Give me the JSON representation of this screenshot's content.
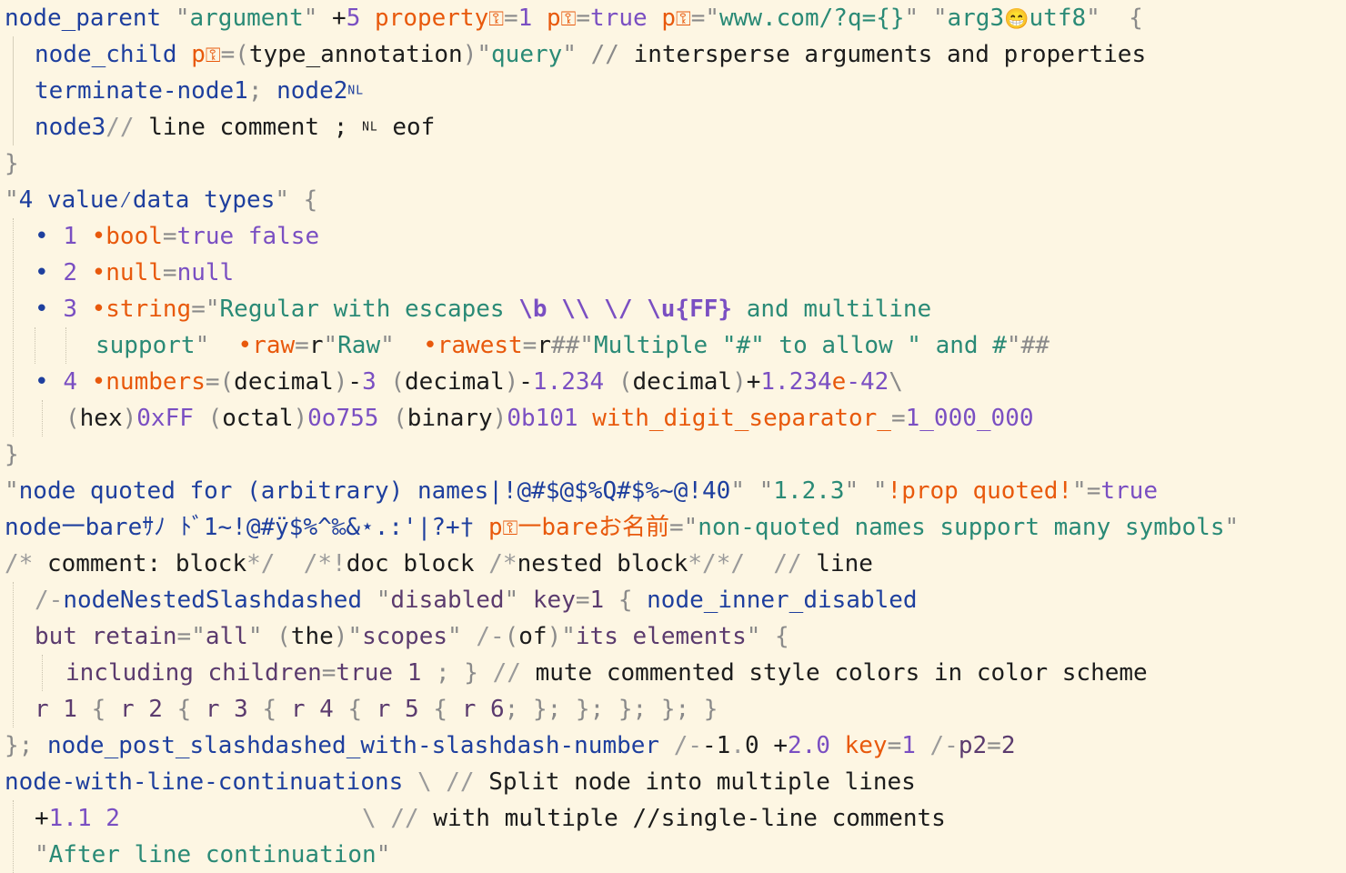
{
  "theme": {
    "background": "#fdf6e3",
    "node": "#1e3f9e",
    "string": "#2a8a76",
    "key": "#e8590c",
    "value": "#7a4fc2",
    "comment": "#9a9a9a"
  },
  "icons": {
    "key_placeholder": "key-placeholder-icon",
    "emoji": "grinning-face-icon"
  },
  "lines": [
    {
      "tokens": [
        {
          "c": "n",
          "t": "node_parent "
        },
        {
          "c": "q",
          "t": "\""
        },
        {
          "c": "s",
          "t": "argument"
        },
        {
          "c": "q",
          "t": "\""
        },
        {
          "c": "t",
          "t": " +"
        },
        {
          "c": "v",
          "t": "5 "
        },
        {
          "c": "k",
          "t": "property"
        },
        {
          "c": "k",
          "t": "⚿",
          "icon": "key-placeholder-icon"
        },
        {
          "c": "p",
          "t": "="
        },
        {
          "c": "v",
          "t": "1 "
        },
        {
          "c": "k",
          "t": "p"
        },
        {
          "c": "k",
          "t": "⚿",
          "icon": "key-placeholder-icon"
        },
        {
          "c": "p",
          "t": "="
        },
        {
          "c": "v",
          "t": "true "
        },
        {
          "c": "k",
          "t": "p"
        },
        {
          "c": "k",
          "t": "⚿",
          "icon": "key-placeholder-icon"
        },
        {
          "c": "p",
          "t": "="
        },
        {
          "c": "q",
          "t": "\""
        },
        {
          "c": "s",
          "t": "www.com/?q={}"
        },
        {
          "c": "q",
          "t": "\" "
        },
        {
          "c": "q",
          "t": "\""
        },
        {
          "c": "s",
          "t": "arg3"
        },
        {
          "c": "t",
          "t": "😁",
          "icon": "grinning-face-icon"
        },
        {
          "c": "s",
          "t": "utf8"
        },
        {
          "c": "q",
          "t": "\"  {"
        }
      ]
    },
    {
      "tokens": [
        {
          "c": "n",
          "t": "node_child "
        },
        {
          "c": "k",
          "t": "p"
        },
        {
          "c": "k",
          "t": "⚿",
          "icon": "key-placeholder-icon"
        },
        {
          "c": "p",
          "t": "=("
        },
        {
          "c": "t",
          "t": "type_annotation"
        },
        {
          "c": "p",
          "t": ")"
        },
        {
          "c": "q",
          "t": "\""
        },
        {
          "c": "s",
          "t": "query"
        },
        {
          "c": "q",
          "t": "\" // "
        },
        {
          "c": "t",
          "t": "intersperse arguments and properties"
        }
      ]
    },
    {
      "tokens": [
        {
          "c": "n",
          "t": "terminate-node1"
        },
        {
          "c": "p",
          "t": "; "
        },
        {
          "c": "n",
          "t": "node2"
        },
        {
          "c": "b",
          "t": "NL",
          "small": true
        }
      ]
    },
    {
      "tokens": [
        {
          "c": "n",
          "t": "node3"
        },
        {
          "c": "c",
          "t": "// "
        },
        {
          "c": "t",
          "t": "line comment ; "
        },
        {
          "c": "t",
          "t": "NL",
          "small": true
        },
        {
          "c": "t",
          "t": " eof"
        }
      ]
    },
    {
      "tokens": [
        {
          "c": "p",
          "t": "}"
        }
      ]
    },
    {
      "tokens": [
        {
          "c": "q",
          "t": "\""
        },
        {
          "c": "n",
          "t": "4 value⁄data types"
        },
        {
          "c": "q",
          "t": "\" {"
        }
      ]
    },
    {
      "tokens": [
        {
          "c": "b",
          "t": "• "
        },
        {
          "c": "v",
          "t": "1 "
        },
        {
          "c": "k",
          "t": "•bool"
        },
        {
          "c": "p",
          "t": "="
        },
        {
          "c": "v",
          "t": "true false"
        }
      ]
    },
    {
      "tokens": [
        {
          "c": "b",
          "t": "• "
        },
        {
          "c": "v",
          "t": "2 "
        },
        {
          "c": "k",
          "t": "•null"
        },
        {
          "c": "p",
          "t": "="
        },
        {
          "c": "v",
          "t": "null"
        }
      ]
    },
    {
      "tokens": [
        {
          "c": "b",
          "t": "• "
        },
        {
          "c": "v",
          "t": "3 "
        },
        {
          "c": "k",
          "t": "•string"
        },
        {
          "c": "p",
          "t": "="
        },
        {
          "c": "q",
          "t": "\""
        },
        {
          "c": "s",
          "t": "Regular with escapes "
        },
        {
          "c": "v",
          "t": "\\b \\\\ \\/ \\u{FF}",
          "bold": true
        },
        {
          "c": "s",
          "t": " and multiline"
        }
      ]
    },
    {
      "tokens": [
        {
          "c": "s",
          "t": "support"
        },
        {
          "c": "q",
          "t": "\"  "
        },
        {
          "c": "k",
          "t": "•raw"
        },
        {
          "c": "p",
          "t": "="
        },
        {
          "c": "t",
          "t": "r"
        },
        {
          "c": "q",
          "t": "\""
        },
        {
          "c": "s",
          "t": "Raw"
        },
        {
          "c": "q",
          "t": "\"  "
        },
        {
          "c": "k",
          "t": "•rawest"
        },
        {
          "c": "p",
          "t": "="
        },
        {
          "c": "t",
          "t": "r"
        },
        {
          "c": "q",
          "t": "##\""
        },
        {
          "c": "s",
          "t": "Multiple \"#\" to allow \" and #"
        },
        {
          "c": "q",
          "t": "\"##"
        }
      ]
    },
    {
      "tokens": [
        {
          "c": "b",
          "t": "• "
        },
        {
          "c": "v",
          "t": "4 "
        },
        {
          "c": "k",
          "t": "•numbers"
        },
        {
          "c": "p",
          "t": "=("
        },
        {
          "c": "t",
          "t": "decimal"
        },
        {
          "c": "p",
          "t": ")"
        },
        {
          "c": "t",
          "t": "-"
        },
        {
          "c": "v",
          "t": "3 "
        },
        {
          "c": "p",
          "t": "("
        },
        {
          "c": "t",
          "t": "decimal"
        },
        {
          "c": "p",
          "t": ")"
        },
        {
          "c": "t",
          "t": "-"
        },
        {
          "c": "v",
          "t": "1.234 "
        },
        {
          "c": "p",
          "t": "("
        },
        {
          "c": "t",
          "t": "decimal"
        },
        {
          "c": "p",
          "t": ")"
        },
        {
          "c": "t",
          "t": "+"
        },
        {
          "c": "v",
          "t": "1.234"
        },
        {
          "c": "k",
          "t": "e"
        },
        {
          "c": "v",
          "t": "-42"
        },
        {
          "c": "p",
          "t": "\\"
        }
      ]
    },
    {
      "tokens": [
        {
          "c": "p",
          "t": "("
        },
        {
          "c": "t",
          "t": "hex"
        },
        {
          "c": "p",
          "t": ")"
        },
        {
          "c": "v",
          "t": "0xFF "
        },
        {
          "c": "p",
          "t": "("
        },
        {
          "c": "t",
          "t": "octal"
        },
        {
          "c": "p",
          "t": ")"
        },
        {
          "c": "v",
          "t": "0o755 "
        },
        {
          "c": "p",
          "t": "("
        },
        {
          "c": "t",
          "t": "binary"
        },
        {
          "c": "p",
          "t": ")"
        },
        {
          "c": "v",
          "t": "0b101 "
        },
        {
          "c": "k",
          "t": "with_digit_separator_"
        },
        {
          "c": "p",
          "t": "="
        },
        {
          "c": "v",
          "t": "1_000_000"
        }
      ]
    },
    {
      "tokens": [
        {
          "c": "p",
          "t": "}"
        }
      ]
    },
    {
      "tokens": [
        {
          "c": "q",
          "t": "\""
        },
        {
          "c": "n",
          "t": "node quoted for (arbitrary) names|!@#$@$%Q#$%~@!40"
        },
        {
          "c": "q",
          "t": "\" "
        },
        {
          "c": "q",
          "t": "\""
        },
        {
          "c": "s",
          "t": "1.2.3"
        },
        {
          "c": "q",
          "t": "\" "
        },
        {
          "c": "q",
          "t": "\""
        },
        {
          "c": "k",
          "t": "!prop quoted!"
        },
        {
          "c": "q",
          "t": "\"="
        },
        {
          "c": "v",
          "t": "true"
        }
      ]
    },
    {
      "tokens": [
        {
          "c": "n",
          "t": "node一bareｻﾉ ﾄﾞ1~!@#ÿ$%^‰&⋆.:'|?+†"
        },
        {
          "c": "t",
          "t": " "
        },
        {
          "c": "k",
          "t": "p"
        },
        {
          "c": "k",
          "t": "⚿",
          "icon": "key-placeholder-icon"
        },
        {
          "c": "k",
          "t": "一bareお名前"
        },
        {
          "c": "p",
          "t": "="
        },
        {
          "c": "q",
          "t": "\""
        },
        {
          "c": "s",
          "t": "non-quoted names support many symbols"
        },
        {
          "c": "q",
          "t": "\""
        }
      ]
    },
    {
      "tokens": [
        {
          "c": "c",
          "t": "/* "
        },
        {
          "c": "t",
          "t": "comment: block"
        },
        {
          "c": "c",
          "t": "*/  /*!"
        },
        {
          "c": "t",
          "t": "doc block "
        },
        {
          "c": "c",
          "t": "/*"
        },
        {
          "c": "t",
          "t": "nested block"
        },
        {
          "c": "c",
          "t": "*/*/  // "
        },
        {
          "c": "t",
          "t": "line"
        }
      ]
    },
    {
      "tokens": [
        {
          "c": "c",
          "t": "/-"
        },
        {
          "c": "n",
          "t": "nodeNestedSlashdashed "
        },
        {
          "c": "q",
          "t": "\""
        },
        {
          "c": "d",
          "t": "disabled"
        },
        {
          "c": "q",
          "t": "\" "
        },
        {
          "c": "d",
          "t": "key"
        },
        {
          "c": "p",
          "t": "="
        },
        {
          "c": "d",
          "t": "1 "
        },
        {
          "c": "p",
          "t": "{ "
        },
        {
          "c": "n",
          "t": "node_inner_disabled"
        }
      ]
    },
    {
      "tokens": [
        {
          "c": "d",
          "t": "but retain"
        },
        {
          "c": "p",
          "t": "="
        },
        {
          "c": "q",
          "t": "\""
        },
        {
          "c": "d",
          "t": "all"
        },
        {
          "c": "q",
          "t": "\" "
        },
        {
          "c": "p",
          "t": "("
        },
        {
          "c": "t",
          "t": "the"
        },
        {
          "c": "p",
          "t": ")"
        },
        {
          "c": "q",
          "t": "\""
        },
        {
          "c": "d",
          "t": "scopes"
        },
        {
          "c": "q",
          "t": "\" "
        },
        {
          "c": "c",
          "t": "/-"
        },
        {
          "c": "p",
          "t": "("
        },
        {
          "c": "t",
          "t": "of"
        },
        {
          "c": "p",
          "t": ")"
        },
        {
          "c": "q",
          "t": "\""
        },
        {
          "c": "d",
          "t": "its elements"
        },
        {
          "c": "q",
          "t": "\" {"
        }
      ]
    },
    {
      "tokens": [
        {
          "c": "d",
          "t": "including children"
        },
        {
          "c": "p",
          "t": "="
        },
        {
          "c": "d",
          "t": "true 1 "
        },
        {
          "c": "p",
          "t": "; } "
        },
        {
          "c": "c",
          "t": "// "
        },
        {
          "c": "t",
          "t": "mute commented style colors in color scheme"
        }
      ]
    },
    {
      "tokens": [
        {
          "c": "d",
          "t": "r 1 "
        },
        {
          "c": "p",
          "t": "{ "
        },
        {
          "c": "d",
          "t": "r 2 "
        },
        {
          "c": "p",
          "t": "{ "
        },
        {
          "c": "d",
          "t": "r 3 "
        },
        {
          "c": "p",
          "t": "{ "
        },
        {
          "c": "d",
          "t": "r 4 "
        },
        {
          "c": "p",
          "t": "{ "
        },
        {
          "c": "d",
          "t": "r 5 "
        },
        {
          "c": "p",
          "t": "{ "
        },
        {
          "c": "d",
          "t": "r 6"
        },
        {
          "c": "p",
          "t": "; }; }; }; }; }"
        }
      ]
    },
    {
      "tokens": [
        {
          "c": "p",
          "t": "}; "
        },
        {
          "c": "n",
          "t": "node_post_slashdashed_with-slashdash-number "
        },
        {
          "c": "c",
          "t": "/-"
        },
        {
          "c": "t",
          "t": "-1"
        },
        {
          "c": "c",
          "t": "."
        },
        {
          "c": "t",
          "t": "0 "
        },
        {
          "c": "t",
          "t": "+"
        },
        {
          "c": "v",
          "t": "2.0 "
        },
        {
          "c": "k",
          "t": "key"
        },
        {
          "c": "p",
          "t": "="
        },
        {
          "c": "v",
          "t": "1 "
        },
        {
          "c": "c",
          "t": "/-"
        },
        {
          "c": "d",
          "t": "p2"
        },
        {
          "c": "p",
          "t": "="
        },
        {
          "c": "d",
          "t": "2"
        }
      ]
    },
    {
      "tokens": [
        {
          "c": "n",
          "t": "node-with-line-continuations "
        },
        {
          "c": "c",
          "t": "\\ // "
        },
        {
          "c": "t",
          "t": "Split node into multiple lines"
        }
      ]
    },
    {
      "tokens": [
        {
          "c": "t",
          "t": "+"
        },
        {
          "c": "v",
          "t": "1.1 2                 "
        },
        {
          "c": "c",
          "t": "\\ // "
        },
        {
          "c": "t",
          "t": "with multiple //single-line comments"
        }
      ]
    },
    {
      "tokens": [
        {
          "c": "q",
          "t": "\""
        },
        {
          "c": "s",
          "t": "After line continuation"
        },
        {
          "c": "q",
          "t": "\""
        }
      ]
    }
  ]
}
